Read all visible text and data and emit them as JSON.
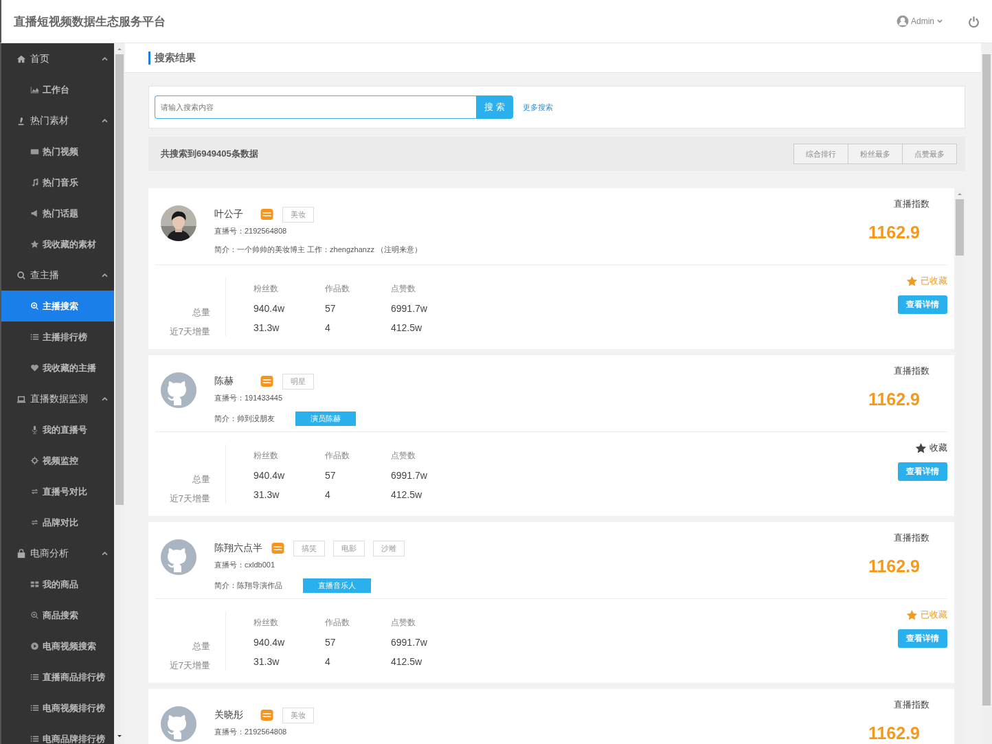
{
  "header": {
    "title": "直播短视频数据生态服务平台",
    "user": "Admin"
  },
  "sidebar": {
    "groups": [
      {
        "label": "首页",
        "expanded": true,
        "children": [
          {
            "label": "工作台",
            "selected": false
          }
        ]
      },
      {
        "label": "热门素材",
        "expanded": true,
        "children": [
          {
            "label": "热门视频",
            "selected": false
          },
          {
            "label": "热门音乐",
            "selected": false
          },
          {
            "label": "热门话题",
            "selected": false
          },
          {
            "label": "我收藏的素材",
            "selected": false
          }
        ]
      },
      {
        "label": "查主播",
        "expanded": true,
        "children": [
          {
            "label": "主播搜索",
            "selected": true
          },
          {
            "label": "主播排行榜",
            "selected": false
          },
          {
            "label": "我收藏的主播",
            "selected": false
          }
        ]
      },
      {
        "label": "直播数据监测",
        "expanded": true,
        "children": [
          {
            "label": "我的直播号",
            "selected": false
          },
          {
            "label": "视频监控",
            "selected": false
          },
          {
            "label": "直播号对比",
            "selected": false
          },
          {
            "label": "品牌对比",
            "selected": false
          }
        ]
      },
      {
        "label": "电商分析",
        "expanded": true,
        "children": [
          {
            "label": "我的商品",
            "selected": false
          },
          {
            "label": "商品搜索",
            "selected": false
          },
          {
            "label": "电商视频搜索",
            "selected": false
          },
          {
            "label": "直播商品排行榜",
            "selected": false
          },
          {
            "label": "电商视频排行榜",
            "selected": false
          },
          {
            "label": "电商品牌排行榜",
            "selected": false
          }
        ]
      }
    ]
  },
  "page_title": "搜索结果",
  "search": {
    "placeholder": "请输入搜索内容",
    "button": "搜 索",
    "more": "更多搜索"
  },
  "result_count": "共搜索到6949405条数据",
  "sort_buttons": [
    "综合排行",
    "粉丝最多",
    "点赞最多"
  ],
  "results": [
    {
      "kind": "picture",
      "name": "叶公子",
      "tags": [
        "美妆"
      ],
      "account": "直播号：2192564808",
      "intro": "简介：一个帅帅的美妆博主 工作：zhengzhanzz （注明来意）",
      "index_label": "直播指数",
      "index_value": "1162.9",
      "favorited": true,
      "favorite_label": "已收藏",
      "detail_button": "查看详情",
      "stat_headers": [
        "粉丝数",
        "作品数",
        "点赞数"
      ],
      "stat_rows": [
        {
          "label": "总量",
          "values": [
            "940.4w",
            "57",
            "6991.7w"
          ]
        },
        {
          "label": "近7天增量",
          "values": [
            "31.3w",
            "4",
            "412.5w"
          ]
        }
      ]
    },
    {
      "kind": "avatar",
      "name": "陈赫",
      "tags": [
        "明星"
      ],
      "account": "直播号：191433445",
      "intro": "简介：帅到没朋友",
      "highlight": "演员陈赫",
      "index_label": "直播指数",
      "index_value": "1162.9",
      "favorited": false,
      "favorite_label": "收藏",
      "detail_button": "查看详情",
      "stat_headers": [
        "粉丝数",
        "作品数",
        "点赞数"
      ],
      "stat_rows": [
        {
          "label": "总量",
          "values": [
            "940.4w",
            "57",
            "6991.7w"
          ]
        },
        {
          "label": "近7天增量",
          "values": [
            "31.3w",
            "4",
            "412.5w"
          ]
        }
      ]
    },
    {
      "kind": "avatar",
      "name": "陈翔六点半",
      "tags": [
        "搞笑",
        "电影",
        "沙雕"
      ],
      "account": "直播号：cxldb001",
      "intro": "简介：陈翔导演作品",
      "highlight": "直播音乐人",
      "index_label": "直播指数",
      "index_value": "1162.9",
      "favorited": true,
      "favorite_label": "已收藏",
      "detail_button": "查看详情",
      "stat_headers": [
        "粉丝数",
        "作品数",
        "点赞数"
      ],
      "stat_rows": [
        {
          "label": "总量",
          "values": [
            "940.4w",
            "57",
            "6991.7w"
          ]
        },
        {
          "label": "近7天增量",
          "values": [
            "31.3w",
            "4",
            "412.5w"
          ]
        }
      ]
    },
    {
      "kind": "avatar",
      "name": "关晓彤",
      "tags": [
        "美妆"
      ],
      "account": "直播号：2192564808",
      "index_label": "直播指数",
      "index_value": "1162.9"
    }
  ]
}
